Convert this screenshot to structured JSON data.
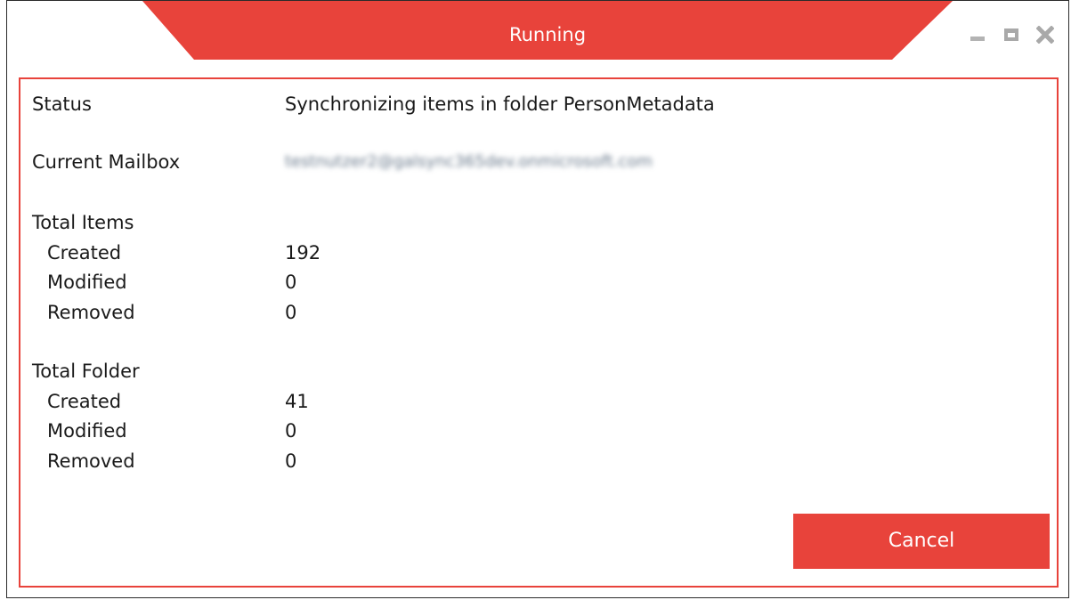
{
  "window": {
    "title": "Running",
    "accent_color": "#e8433b",
    "controls": [
      "minimize-icon",
      "maximize-icon",
      "close-icon"
    ]
  },
  "status": {
    "label": "Status",
    "value": "Synchronizing items in folder PersonMetadata"
  },
  "mailbox": {
    "label": "Current Mailbox",
    "value": "testnutzer2@galsync365dev.onmicrosoft.com"
  },
  "total_items": {
    "heading": "Total Items",
    "created_label": "Created",
    "created_value": "192",
    "modified_label": "Modified",
    "modified_value": "0",
    "removed_label": "Removed",
    "removed_value": "0"
  },
  "total_folder": {
    "heading": "Total Folder",
    "created_label": "Created",
    "created_value": "41",
    "modified_label": "Modified",
    "modified_value": "0",
    "removed_label": "Removed",
    "removed_value": "0"
  },
  "actions": {
    "cancel_label": "Cancel"
  }
}
